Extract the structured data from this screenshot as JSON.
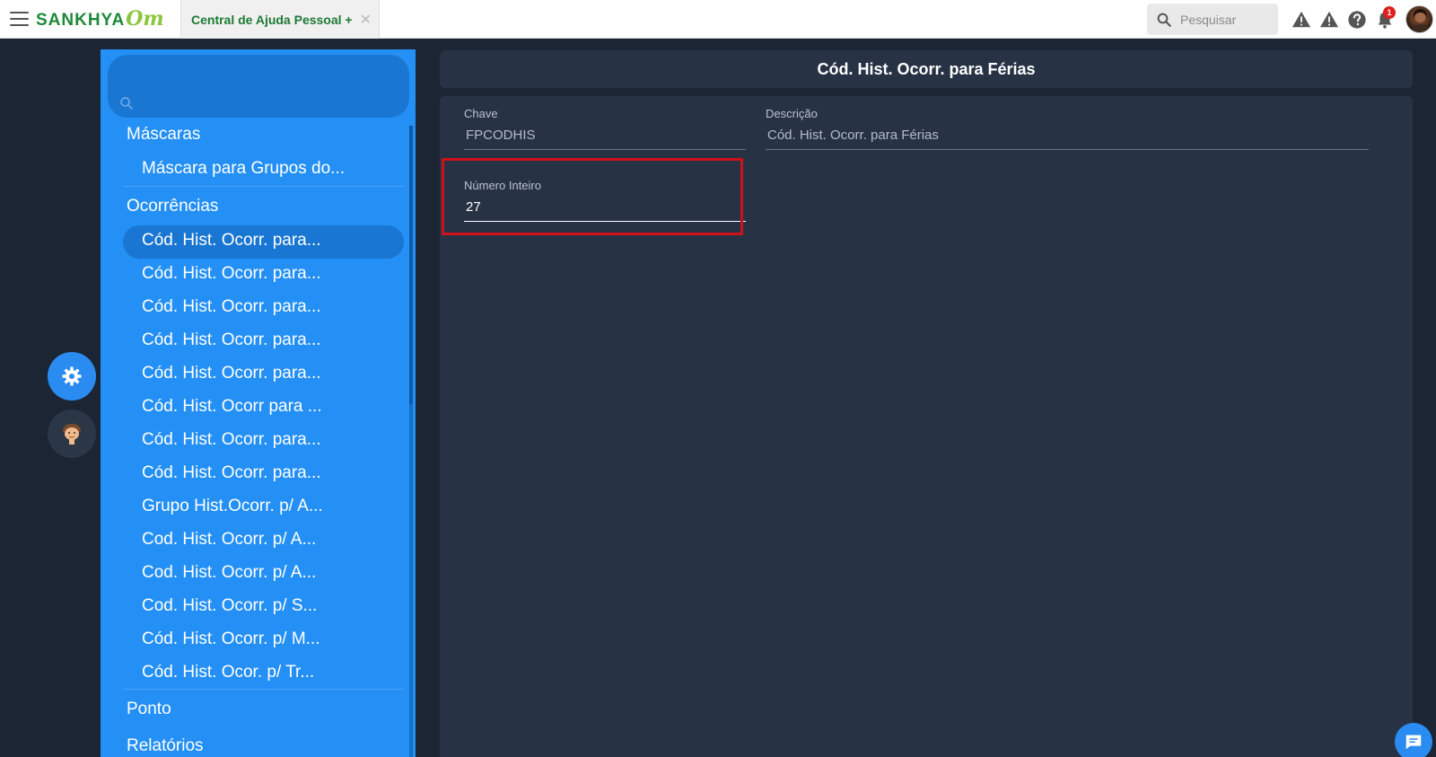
{
  "topbar": {
    "logo_main": "SANKHYA",
    "logo_om": "Om",
    "tab_label": "Central de Ajuda Pessoal +",
    "tab_close": "✕",
    "search_placeholder": "Pesquisar",
    "notification_count": "1",
    "icons": [
      "menu-icon",
      "search-icon",
      "warning-icon",
      "warning-icon",
      "help-icon",
      "bell-icon",
      "avatar"
    ]
  },
  "sidebar": {
    "items": [
      {
        "label": "Máscaras",
        "type": "group"
      },
      {
        "label": "Máscara para Grupos do...",
        "type": "sub"
      },
      {
        "label": "Ocorrências",
        "type": "group"
      },
      {
        "label": "Cód. Hist. Ocorr. para...",
        "type": "sub",
        "selected": true
      },
      {
        "label": "Cód. Hist. Ocorr. para...",
        "type": "sub"
      },
      {
        "label": "Cód. Hist. Ocorr. para...",
        "type": "sub"
      },
      {
        "label": "Cód. Hist. Ocorr. para...",
        "type": "sub"
      },
      {
        "label": "Cód. Hist. Ocorr. para...",
        "type": "sub"
      },
      {
        "label": "Cód. Hist. Ocorr para ...",
        "type": "sub"
      },
      {
        "label": "Cód. Hist. Ocorr. para...",
        "type": "sub"
      },
      {
        "label": "Cód. Hist. Ocorr. para...",
        "type": "sub"
      },
      {
        "label": "Grupo Hist.Ocorr. p/ A...",
        "type": "sub"
      },
      {
        "label": "Cod. Hist. Ocorr. p/ A...",
        "type": "sub"
      },
      {
        "label": "Cod. Hist. Ocorr. p/ A...",
        "type": "sub"
      },
      {
        "label": "Cod. Hist. Ocorr. p/ S...",
        "type": "sub"
      },
      {
        "label": "Cód. Hist. Ocorr. p/ M...",
        "type": "sub"
      },
      {
        "label": "Cód. Hist. Ocor. p/ Tr...",
        "type": "sub"
      },
      {
        "label": "Ponto",
        "type": "group"
      },
      {
        "label": "Relatórios",
        "type": "group"
      }
    ]
  },
  "main": {
    "title": "Cód. Hist. Ocorr. para Férias",
    "fields": {
      "chave_label": "Chave",
      "chave_value": "FPCODHIS",
      "descricao_label": "Descrição",
      "descricao_value": "Cód. Hist. Ocorr. para Férias",
      "numero_label": "Número Inteiro",
      "numero_value": "27"
    }
  },
  "colors": {
    "sidebar_bg": "#2490f5",
    "sidebar_selected": "#1976d2",
    "page_bg": "#1b2533",
    "panel_bg": "#273244",
    "highlight_border": "#d0101a",
    "brand_green": "#1d8a3a"
  }
}
